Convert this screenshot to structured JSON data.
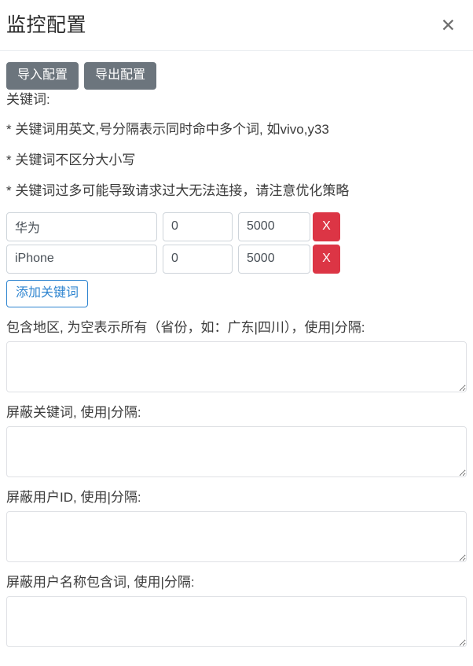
{
  "header": {
    "title": "监控配置",
    "close_label": "✕"
  },
  "toolbar": {
    "import_label": "导入配置",
    "export_label": "导出配置"
  },
  "hints": {
    "keyword_heading": "关键词:",
    "line1": "* 关键词用英文,号分隔表示同时命中多个词, 如vivo,y33",
    "line2": "* 关键词不区分大小写",
    "line3": "* 关键词过多可能导致请求过大无法连接，请注意优化策略"
  },
  "keywords": {
    "rows": [
      {
        "word": "华为",
        "min": "0",
        "max": "5000",
        "delete_label": "X"
      },
      {
        "word": "iPhone",
        "min": "0",
        "max": "5000",
        "delete_label": "X"
      }
    ],
    "add_label": "添加关键词",
    "word_placeholder": "",
    "min_placeholder": "",
    "max_placeholder": ""
  },
  "fields": [
    {
      "label": "包含地区, 为空表示所有（省份，如：广东|四川），使用|分隔:",
      "value": "",
      "placeholder": ""
    },
    {
      "label": "屏蔽关键词, 使用|分隔:",
      "value": "",
      "placeholder": ""
    },
    {
      "label": "屏蔽用户ID, 使用|分隔:",
      "value": "",
      "placeholder": ""
    },
    {
      "label": "屏蔽用户名称包含词, 使用|分隔:",
      "value": "",
      "placeholder": ""
    }
  ],
  "colors": {
    "secondary": "#6c757d",
    "danger": "#dc3545",
    "primary": "#2f85d0",
    "border": "#ced4da"
  }
}
